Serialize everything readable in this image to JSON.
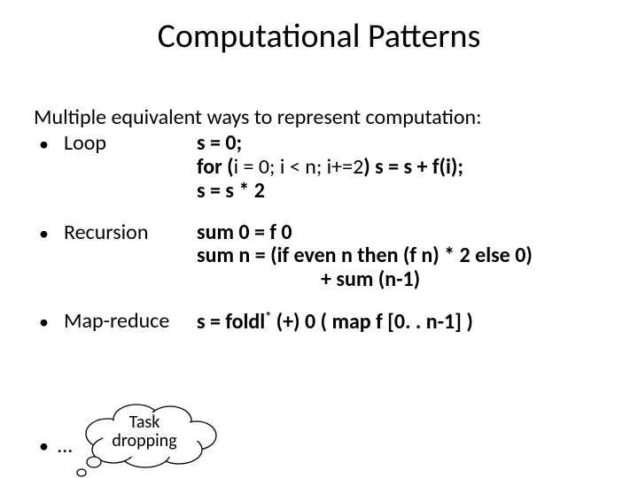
{
  "title": "Computational Patterns",
  "intro": "Multiple equivalent ways to represent computation:",
  "bullets": {
    "loop": {
      "label": "Loop",
      "code": {
        "l1a": "s = 0;",
        "l2a": "for (",
        "l2b": "i = 0; i < n; i+=2",
        "l2c": ")  s = s + f(i);",
        "l3a": "s = s * 2"
      }
    },
    "recursion": {
      "label": "Recursion",
      "code": {
        "l1a": "sum 0 = f 0",
        "l2a": "sum n = (",
        "l2b": "if",
        "l2c": " even n ",
        "l2d": "then",
        "l2e": " (f n) * 2 ",
        "l2f": "else",
        "l2g": " 0)",
        "l3a": "+ sum (n-1)"
      }
    },
    "mapreduce": {
      "label": "Map-reduce",
      "code": {
        "l1a": "s = ",
        "l1b": "foldl",
        "l1sup": "*",
        "l1c": " (+) 0 ( map f [0. . n-1] )"
      }
    },
    "more": {
      "label": "…"
    }
  },
  "cloud": {
    "line1": "Task",
    "line2": "dropping"
  }
}
